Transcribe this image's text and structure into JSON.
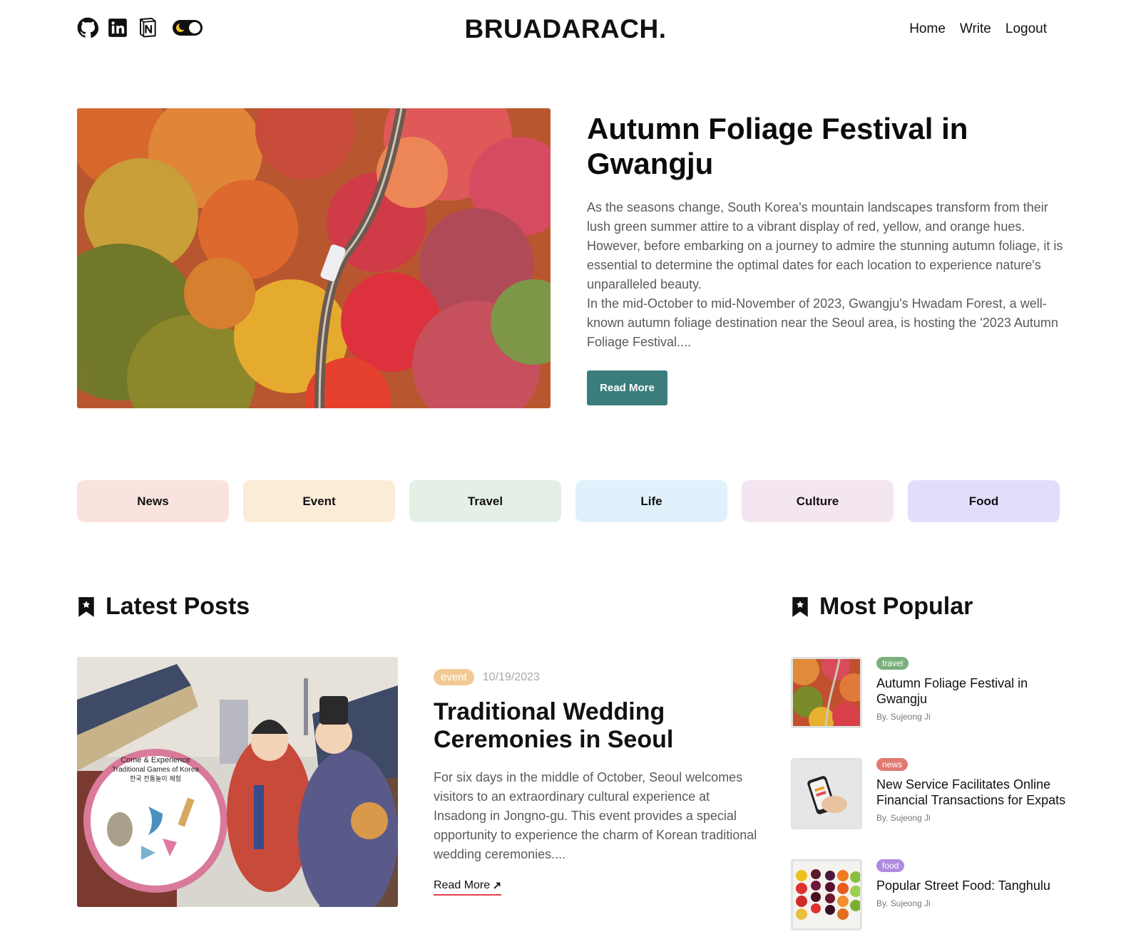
{
  "header": {
    "logo": "BRUADARACH.",
    "social_icons": [
      "github-icon",
      "linkedin-icon",
      "notion-icon"
    ],
    "theme_toggle": "dark-mode-toggle",
    "nav": [
      "Home",
      "Write",
      "Logout"
    ]
  },
  "hero": {
    "title": "Autumn Foliage Festival in Gwangju",
    "paragraph1": "As the seasons change, South Korea's mountain landscapes transform from their lush green summer attire to a vibrant display of red, yellow, and orange hues. However, before embarking on a journey to admire the stunning autumn foliage, it is essential to determine the optimal dates for each location to experience nature's unparalleled beauty.",
    "paragraph2": "In the mid-October to mid-November of 2023, Gwangju's Hwadam Forest, a well-known autumn foliage destination near the Seoul area, is hosting the '2023 Autumn Foliage Festival....",
    "button": "Read More"
  },
  "categories": [
    {
      "label": "News",
      "color": "#fae3de"
    },
    {
      "label": "Event",
      "color": "#fbecd8"
    },
    {
      "label": "Travel",
      "color": "#e4efe5"
    },
    {
      "label": "Life",
      "color": "#e1f1fc"
    },
    {
      "label": "Culture",
      "color": "#f4e6f1"
    },
    {
      "label": "Food",
      "color": "#e1defb"
    }
  ],
  "latest": {
    "section_title": "Latest Posts",
    "badge": "event",
    "date": "10/19/2023",
    "title": "Traditional Wedding Ceremonies in Seoul",
    "excerpt": "For six days in the middle of October, Seoul welcomes visitors to an extraordinary cultural experience at Insadong in Jongno-gu. This event provides a special opportunity to experience the charm of Korean traditional wedding ceremonies....",
    "read_more": "Read More",
    "image_text": {
      "line1": "Come & Experience",
      "line2": "Traditional Games of Korea",
      "line3": "한국 전통놀이 체험"
    }
  },
  "popular": {
    "section_title": "Most Popular",
    "items": [
      {
        "badge": "travel",
        "badge_color": "#7bb07e",
        "title": "Autumn Foliage Festival in Gwangju",
        "author": "By. Sujeong Ji"
      },
      {
        "badge": "news",
        "badge_color": "#e07a72",
        "title": "New Service Facilitates Online Financial Transactions for Expats",
        "author": "By. Sujeong Ji"
      },
      {
        "badge": "food",
        "badge_color": "#b08ce0",
        "title": "Popular Street Food: Tanghulu",
        "author": "By. Sujeong Ji"
      }
    ]
  }
}
